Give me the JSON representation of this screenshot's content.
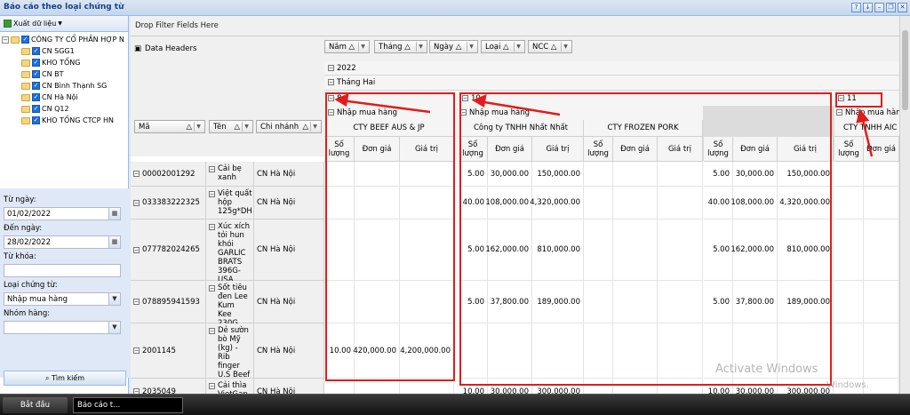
{
  "window": {
    "title": "Báo cáo theo loại chứng từ",
    "buttons": [
      "?",
      "↓",
      "–",
      "❐",
      "✕"
    ]
  },
  "left_toolbar": {
    "export_label": "Xuất dữ liệu"
  },
  "tree": {
    "root": "CÔNG TY CỔ PHẦN HỢP N",
    "children": [
      "CN SGG1",
      "KHO TỔNG",
      "CN BT",
      "CN Bình Thạnh SG",
      "CN Hà Nội",
      "CN Q12",
      "KHO TỔNG CTCP HN"
    ]
  },
  "filters": {
    "from_label": "Từ ngày:",
    "from_value": "01/02/2022",
    "to_label": "Đến ngày:",
    "to_value": "28/02/2022",
    "keyword_label": "Từ khóa:",
    "keyword_value": "",
    "doctype_label": "Loại chứng từ:",
    "doctype_value": "Nhập mua hàng",
    "group_label": "Nhóm hàng:",
    "group_value": "",
    "search_button": "Tìm kiếm"
  },
  "pivot": {
    "drop_filter": "Drop Filter Fields Here",
    "data_headers": "Data Headers",
    "column_fields": [
      "Năm",
      "Tháng",
      "Ngày",
      "Loại",
      "NCC"
    ],
    "row_fields": [
      "Mã",
      "Tên",
      "Chi nhánh"
    ],
    "year": "2022",
    "month": "Tháng Hai",
    "days": [
      "8",
      "10",
      "11"
    ],
    "doc_type": "Nhập mua hàng",
    "suppliers": [
      "CTY BEEF AUS & JP",
      "Công ty TNHH Nhất Nhất",
      "CTY FROZEN PORK",
      "CTY TNHH AIC"
    ],
    "measures": [
      "Số lượng",
      "Đơn giá",
      "Giá trị"
    ],
    "rows": [
      {
        "ma": "00002001292",
        "ten": "Cải bẹ xanh",
        "cn": "CN Hà Nội",
        "d8": [
          "",
          "",
          ""
        ],
        "nhat": [
          "5.00",
          "30,000.00",
          "150,000.00"
        ],
        "frozen": [
          "",
          "",
          ""
        ],
        "total": [
          "5.00",
          "30,000.00",
          "150,000.00"
        ]
      },
      {
        "ma": "033383222325",
        "ten": "Việt quất hộp 125g*DH",
        "cn": "CN Hà Nội",
        "d8": [
          "",
          "",
          ""
        ],
        "nhat": [
          "40.00",
          "108,000.00",
          "4,320,000.00"
        ],
        "frozen": [
          "",
          "",
          ""
        ],
        "total": [
          "40.00",
          "108,000.00",
          "4,320,000.00"
        ]
      },
      {
        "ma": "077782024265",
        "ten": "Xúc xích tỏi hun khói GARLIC BRATS 396G-USA",
        "cn": "CN Hà Nội",
        "d8": [
          "",
          "",
          ""
        ],
        "nhat": [
          "5.00",
          "162,000.00",
          "810,000.00"
        ],
        "frozen": [
          "",
          "",
          ""
        ],
        "total": [
          "5.00",
          "162,000.00",
          "810,000.00"
        ]
      },
      {
        "ma": "078895941593",
        "ten": "Sốt tiêu đen Lee Kum Kee 230G",
        "cn": "CN Hà Nội",
        "d8": [
          "",
          "",
          ""
        ],
        "nhat": [
          "5.00",
          "37,800.00",
          "189,000.00"
        ],
        "frozen": [
          "",
          "",
          ""
        ],
        "total": [
          "5.00",
          "37,800.00",
          "189,000.00"
        ]
      },
      {
        "ma": "2001145",
        "ten": "Dẻ sườn bò Mỹ (kg) - Rib finger U.S Beef",
        "cn": "CN Hà Nội",
        "d8": [
          "10.00",
          "420,000.00",
          "4,200,000.00"
        ],
        "nhat": [
          "",
          "",
          ""
        ],
        "frozen": [
          "",
          "",
          ""
        ],
        "total": [
          "",
          "",
          ""
        ]
      },
      {
        "ma": "2035049",
        "ten": "Cải thìa VietGap",
        "cn": "CN Hà Nội",
        "d8": [
          "",
          "",
          ""
        ],
        "nhat": [
          "10.00",
          "30,000.00",
          "300,000.00"
        ],
        "frozen": [
          "",
          "",
          ""
        ],
        "total": [
          "10.00",
          "30,000.00",
          "300,000.00"
        ]
      }
    ]
  },
  "watermark": {
    "line1": "Activate Windows",
    "line2": "Windows."
  },
  "taskbar": {
    "start": "Bắt đầu",
    "task": "Báo cáo t..."
  }
}
